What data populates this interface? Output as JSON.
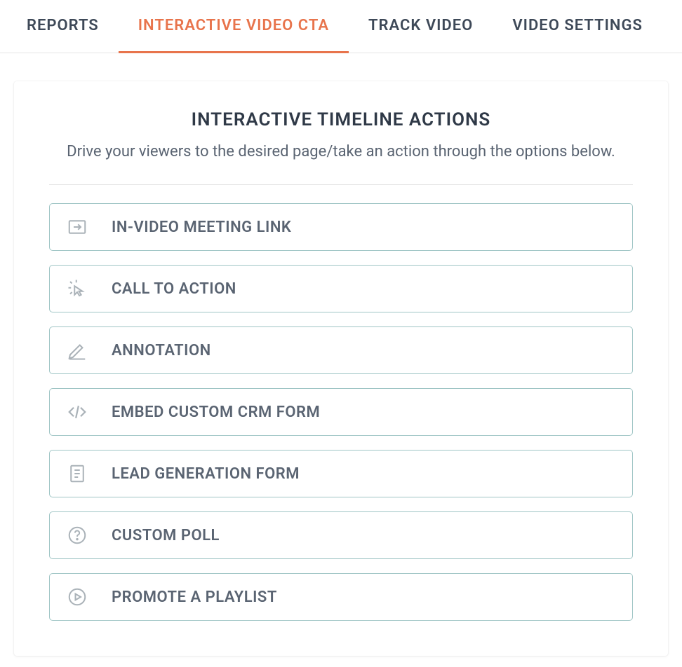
{
  "tabs": [
    {
      "label": "REPORTS",
      "active": false
    },
    {
      "label": "INTERACTIVE VIDEO CTA",
      "active": true
    },
    {
      "label": "TRACK VIDEO",
      "active": false
    },
    {
      "label": "VIDEO SETTINGS",
      "active": false
    }
  ],
  "panel": {
    "title": "INTERACTIVE TIMELINE ACTIONS",
    "subtitle": "Drive your viewers to the desired page/take an action through the options below."
  },
  "actions": [
    {
      "label": "IN-VIDEO MEETING LINK",
      "icon": "arrow-box-icon"
    },
    {
      "label": "CALL TO ACTION",
      "icon": "cursor-click-icon"
    },
    {
      "label": "ANNOTATION",
      "icon": "pencil-icon"
    },
    {
      "label": "EMBED CUSTOM CRM FORM",
      "icon": "code-icon"
    },
    {
      "label": "LEAD GENERATION FORM",
      "icon": "form-icon"
    },
    {
      "label": "CUSTOM POLL",
      "icon": "question-circle-icon"
    },
    {
      "label": "PROMOTE A PLAYLIST",
      "icon": "play-circle-icon"
    }
  ]
}
